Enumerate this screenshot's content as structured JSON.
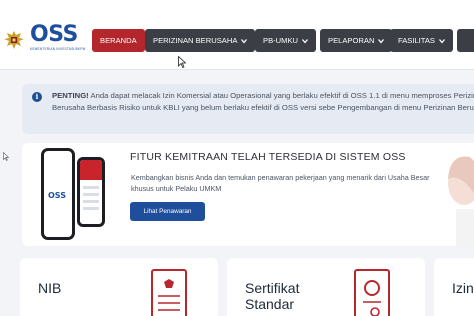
{
  "header": {
    "logo_text": "OSS",
    "logo_subtext": "KEMENTERIAN INVESTASI/BKPM",
    "nav": [
      {
        "label": "BERANDA",
        "active": true,
        "has_dropdown": false
      },
      {
        "label": "PERIZINAN BERUSAHA",
        "active": false,
        "has_dropdown": true
      },
      {
        "label": "PB-UMKU",
        "active": false,
        "has_dropdown": true
      },
      {
        "label": "PELAPORAN",
        "active": false,
        "has_dropdown": true
      },
      {
        "label": "FASILITAS",
        "active": false,
        "has_dropdown": true
      }
    ]
  },
  "alert": {
    "icon": "info-icon",
    "strong": "PENTING!",
    "text": " Anda dapat melacak Izin Komersial atau Operasional yang berlaku efektif di OSS 1.1 di menu memproses Perizinan Berusaha Berbasis Risiko untuk KBLI yang belum berlaku efektif di OSS versi sebe Pengembangan di menu Perizinan Berusaha"
  },
  "feature": {
    "title": "FITUR KEMITRAAN TELAH TERSEDIA DI SISTEM OSS",
    "description": "Kembangkan bisnis Anda dan temukan penawaran pekerjaan yang menarik dari Usaha Besar khusus untuk Pelaku UMKM",
    "button_label": "Lihat Penawaran",
    "phone_logo": "OSS"
  },
  "cards": [
    {
      "title": "NIB",
      "icon": "document-seal-icon"
    },
    {
      "title": "Sertifikat Standar",
      "icon": "certificate-icon"
    },
    {
      "title": "Izin",
      "icon": ""
    }
  ],
  "colors": {
    "brand_blue": "#1f4f9c",
    "active_red": "#b3262b",
    "nav_dark": "#3b3e45",
    "alert_bg": "#e6eaf3"
  }
}
